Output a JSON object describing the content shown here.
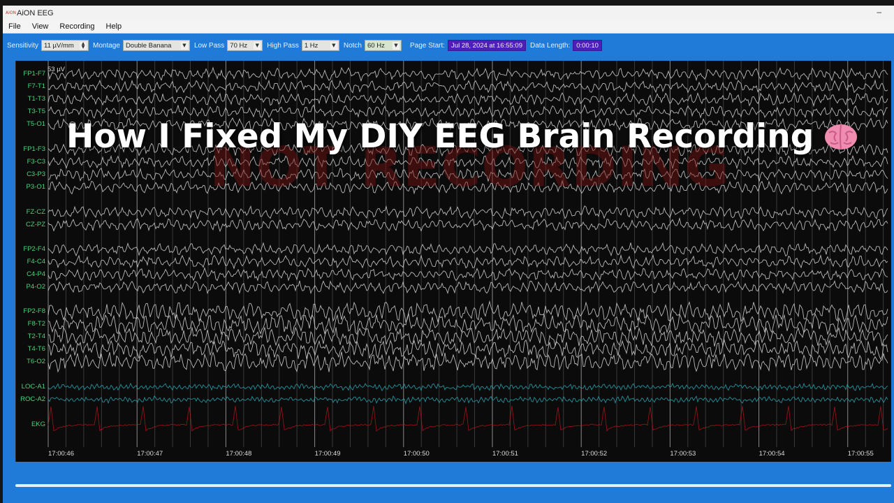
{
  "window": {
    "title": "AiON EEG",
    "logo_text": "AiON",
    "minimize": "–"
  },
  "menu": [
    "File",
    "View",
    "Recording",
    "Help"
  ],
  "toolbar": {
    "sensitivity_label": "Sensitivity",
    "sensitivity_value": "11 µV/mm",
    "montage_label": "Montage",
    "montage_value": "Double Banana",
    "lowpass_label": "Low Pass",
    "lowpass_value": "70 Hz",
    "highpass_label": "High Pass",
    "highpass_value": "1 Hz",
    "notch_label": "Notch",
    "notch_value": "60 Hz",
    "page_start_label": "Page Start:",
    "page_start_value": "Jul 28, 2024 at 16:55:09",
    "data_length_label": "Data Length:",
    "data_length_value": "0:00:10"
  },
  "eeg": {
    "scale": "53 µV",
    "channels": [
      "FP1-F7",
      "F7-T1",
      "T1-T3",
      "T3-T5",
      "T5-O1",
      "FP1-F3",
      "F3-C3",
      "C3-P3",
      "P3-O1",
      "FZ-CZ",
      "CZ-PZ",
      "FP2-F4",
      "F4-C4",
      "C4-P4",
      "P4-O2",
      "FP2-F8",
      "F8-T2",
      "T2-T4",
      "T4-T6",
      "T6-O2",
      "LOC-A1",
      "ROC-A2",
      "EKG"
    ],
    "times": [
      "17:00:46",
      "17:00:47",
      "17:00:48",
      "17:00:49",
      "17:00:50",
      "17:00:51",
      "17:00:52",
      "17:00:53",
      "17:00:54",
      "17:00:55"
    ],
    "trace_color": "#d8d8d8",
    "eog_color": "#2aa7b4",
    "ekg_color": "#c0141c",
    "label_color": "#4ed27a"
  },
  "watermark": "NOT RECORDING",
  "overlay_title": "How I Fixed My DIY EEG Brain Recording",
  "overlay_icon": "brain-icon"
}
